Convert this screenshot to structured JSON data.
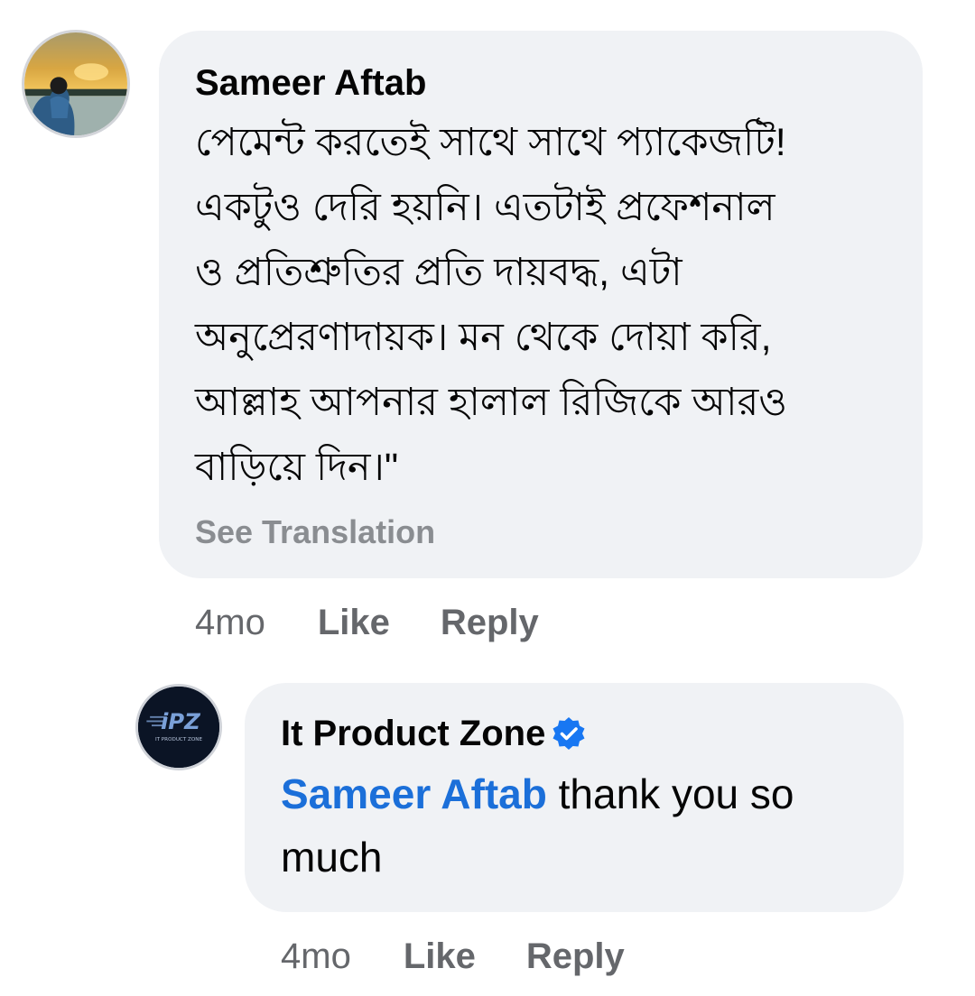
{
  "comment": {
    "author": "Sameer Aftab",
    "text_lines": [
      "পেমেন্ট করতেই সাথে সাথে প্যাকেজটি!",
      "একটুও দেরি হয়নি। এতটাই প্রফেশনাল",
      "ও প্রতিশ্রুতির প্রতি দায়বদ্ধ, এটা",
      "অনুপ্রেরণাদায়ক। মন থেকে দোয়া করি,",
      "আল্লাহ আপনার হালাল রিজিকে আরও",
      "বাড়িয়ে দিন।\""
    ],
    "see_translation": "See Translation",
    "timestamp": "4mo",
    "like_label": "Like",
    "reply_label": "Reply",
    "avatar_icon": "user-avatar-photo"
  },
  "reply": {
    "author": "It Product Zone",
    "verified_icon": "verified-badge-icon",
    "mention": "Sameer Aftab",
    "text_line1": " thank you so",
    "text_line2": "much",
    "timestamp": "4mo",
    "like_label": "Like",
    "reply_label": "Reply",
    "avatar_logo_text": "iPZ",
    "avatar_logo_subtext": "IT PRODUCT ZONE"
  },
  "colors": {
    "bubble_bg": "#f0f2f5",
    "text": "#050505",
    "secondary": "#65676b",
    "muted": "#8a8d91",
    "mention": "#1b6fd9",
    "verified": "#1877f2"
  }
}
